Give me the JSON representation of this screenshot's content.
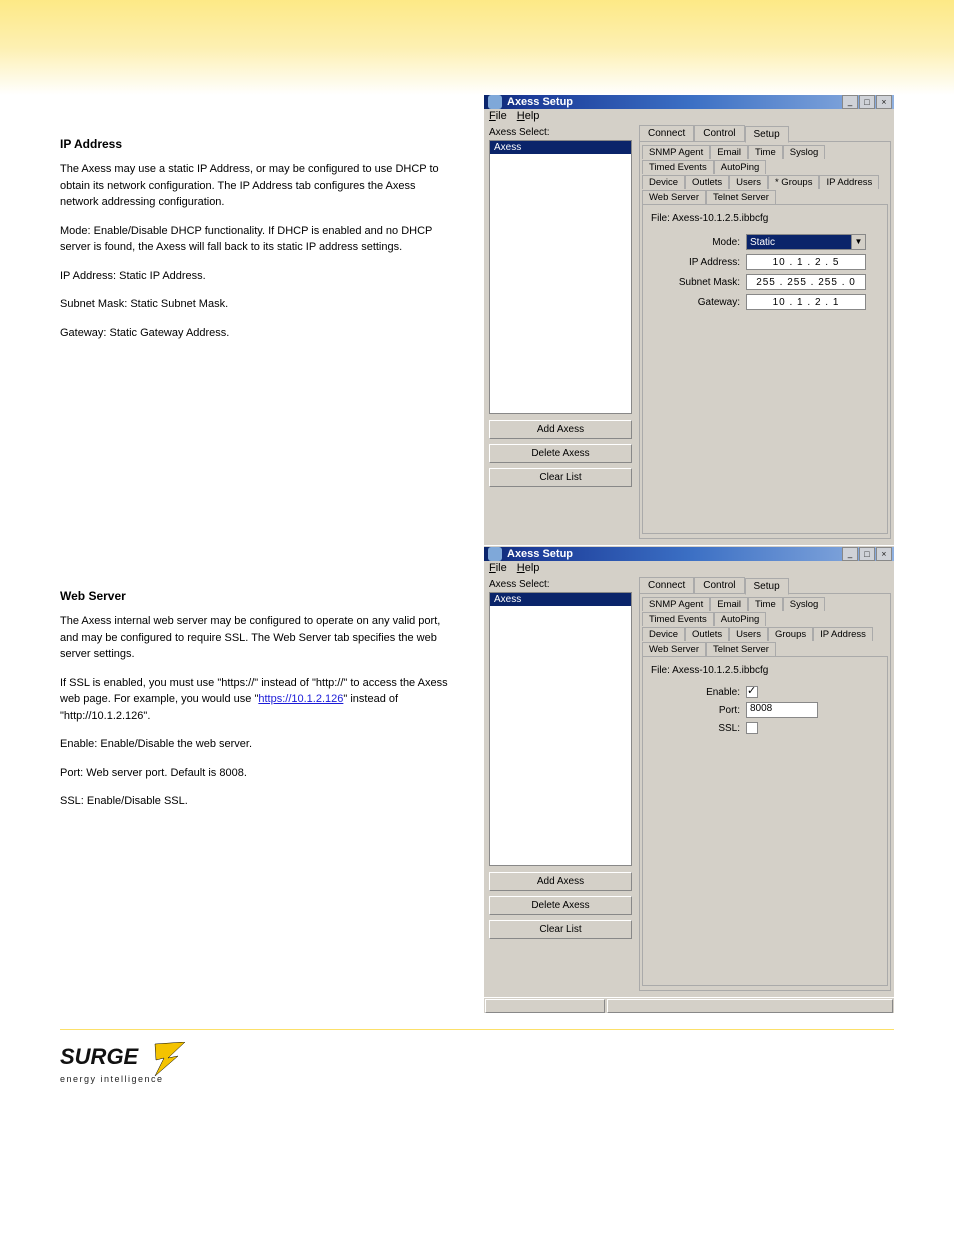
{
  "sections": [
    {
      "title": "IP Address",
      "paragraphs": [
        "The Axess may use a static IP Address, or may be configured to use DHCP to obtain its network configuration. The IP Address tab configures the Axess network addressing configuration.",
        "Mode: Enable/Disable DHCP functionality. If DHCP is enabled and no DHCP server is found, the Axess will fall back to its static IP address settings.",
        "IP Address: Static IP Address.",
        "Subnet Mask: Static Subnet Mask.",
        "Gateway: Static Gateway Address."
      ]
    },
    {
      "title": "Web Server",
      "paragraphs": [
        "The Axess internal web server may be configured to operate on any valid port, and may be configured to require SSL. The Web Server tab specifies the web server settings.",
        "If SSL is enabled, you must use \"https://\" instead of \"http://\" to access the Axess web page. For example, you would use \"https://10.1.2.126\" instead of \"http://10.1.2.126\".",
        "Enable: Enable/Disable the web server.",
        "Port: Web server port. Default is 8008.",
        "SSL: Enable/Disable SSL."
      ]
    }
  ],
  "win": {
    "title": "Axess Setup",
    "menu": {
      "file": {
        "label": "File",
        "u": "F"
      },
      "help": {
        "label": "Help",
        "u": "H"
      }
    },
    "axessSelectLabel": "Axess Select:",
    "listItem": "Axess",
    "buttons": {
      "add": "Add Axess",
      "del": "Delete Axess",
      "clear": "Clear List"
    },
    "topTabs": [
      "Connect",
      "Control",
      "Setup"
    ],
    "topSel": 2,
    "subTabsRow1": [
      "SNMP Agent",
      "Email",
      "Time",
      "Syslog",
      "Timed Events",
      "AutoPing"
    ],
    "subTabsRow2": [
      "Device",
      "Outlets",
      "Users",
      "* Groups",
      "IP Address",
      "Web Server",
      "Telnet Server"
    ],
    "fileLine": "File: Axess-10.1.2.5.ibbcfg"
  },
  "ipPanel": {
    "selSub": "IP Address",
    "fields": {
      "modeLabel": "Mode:",
      "modeValue": "Static",
      "ipLabel": "IP Address:",
      "ipValue": "10 . 1 . 2 . 5",
      "maskLabel": "Subnet Mask:",
      "maskValue": "255 . 255 . 255 . 0",
      "gwLabel": "Gateway:",
      "gwValue": "10 . 1 . 2 . 1"
    }
  },
  "webPanel": {
    "selSub": "Web Server",
    "row2GroupsPlain": "Groups",
    "fields": {
      "enableLabel": "Enable:",
      "enableChecked": true,
      "portLabel": "Port:",
      "portValue": "8008",
      "sslLabel": "SSL:",
      "sslChecked": false
    }
  },
  "logo": {
    "line1": "SURGE",
    "line2": "energy intelligence"
  }
}
